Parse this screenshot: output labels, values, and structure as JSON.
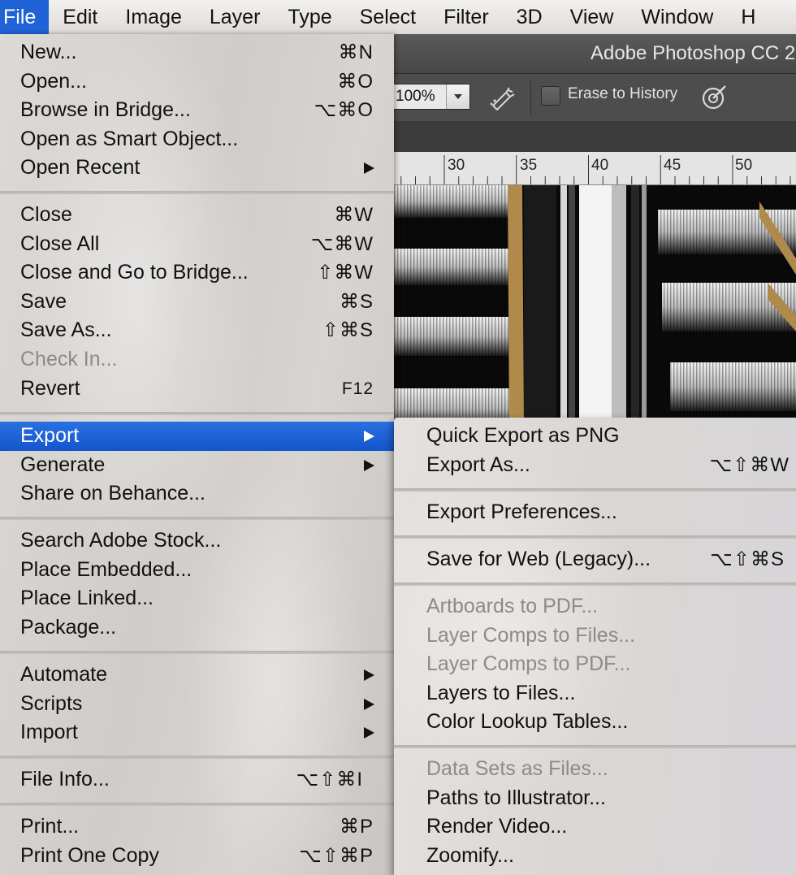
{
  "menubar": {
    "items": [
      "File",
      "Edit",
      "Image",
      "Layer",
      "Type",
      "Select",
      "Filter",
      "3D",
      "View",
      "Window",
      "H"
    ]
  },
  "photoshop": {
    "title": "Adobe Photoshop CC 2",
    "zoom": "100%",
    "erase_to_history_label": "Erase to History",
    "erase_to_history_checked": false,
    "ruler_labels": [
      "30",
      "35",
      "40",
      "45",
      "50"
    ]
  },
  "file_menu": {
    "items": [
      {
        "label": "New...",
        "shortcut": "⌘N"
      },
      {
        "label": "Open...",
        "shortcut": "⌘O"
      },
      {
        "label": "Browse in Bridge...",
        "shortcut": "⌥⌘O"
      },
      {
        "label": "Open as Smart Object...",
        "shortcut": ""
      },
      {
        "label": "Open Recent",
        "shortcut": "",
        "submenu": true
      },
      {
        "label": "Close",
        "shortcut": "⌘W"
      },
      {
        "label": "Close All",
        "shortcut": "⌥⌘W"
      },
      {
        "label": "Close and Go to Bridge...",
        "shortcut": "⇧⌘W"
      },
      {
        "label": "Save",
        "shortcut": "⌘S"
      },
      {
        "label": "Save As...",
        "shortcut": "⇧⌘S"
      },
      {
        "label": "Check In...",
        "shortcut": "",
        "disabled": true
      },
      {
        "label": "Revert",
        "shortcut": "F12"
      },
      {
        "label": "Export",
        "shortcut": "",
        "submenu": true,
        "highlighted": true
      },
      {
        "label": "Generate",
        "shortcut": "",
        "submenu": true
      },
      {
        "label": "Share on Behance...",
        "shortcut": ""
      },
      {
        "label": "Search Adobe Stock...",
        "shortcut": ""
      },
      {
        "label": "Place Embedded...",
        "shortcut": ""
      },
      {
        "label": "Place Linked...",
        "shortcut": ""
      },
      {
        "label": "Package...",
        "shortcut": ""
      },
      {
        "label": "Automate",
        "shortcut": "",
        "submenu": true
      },
      {
        "label": "Scripts",
        "shortcut": "",
        "submenu": true
      },
      {
        "label": "Import",
        "shortcut": "",
        "submenu": true
      },
      {
        "label": "File Info...",
        "shortcut": "⌥⇧⌘I"
      },
      {
        "label": "Print...",
        "shortcut": "⌘P"
      },
      {
        "label": "Print One Copy",
        "shortcut": "⌥⇧⌘P"
      }
    ]
  },
  "export_menu": {
    "items": [
      {
        "label": "Quick Export as PNG",
        "shortcut": ""
      },
      {
        "label": "Export As...",
        "shortcut": "⌥⇧⌘W"
      },
      {
        "label": "Export Preferences...",
        "shortcut": ""
      },
      {
        "label": "Save for Web (Legacy)...",
        "shortcut": "⌥⇧⌘S"
      },
      {
        "label": "Artboards to PDF...",
        "shortcut": "",
        "disabled": true
      },
      {
        "label": "Layer Comps to Files...",
        "shortcut": "",
        "disabled": true
      },
      {
        "label": "Layer Comps to PDF...",
        "shortcut": "",
        "disabled": true
      },
      {
        "label": "Layers to Files...",
        "shortcut": ""
      },
      {
        "label": "Color Lookup Tables...",
        "shortcut": ""
      },
      {
        "label": "Data Sets as Files...",
        "shortcut": "",
        "disabled": true
      },
      {
        "label": "Paths to Illustrator...",
        "shortcut": ""
      },
      {
        "label": "Render Video...",
        "shortcut": ""
      },
      {
        "label": "Zoomify...",
        "shortcut": ""
      }
    ]
  },
  "colors": {
    "highlight": "#1f63d6",
    "disabled_text": "#8d8b89"
  }
}
